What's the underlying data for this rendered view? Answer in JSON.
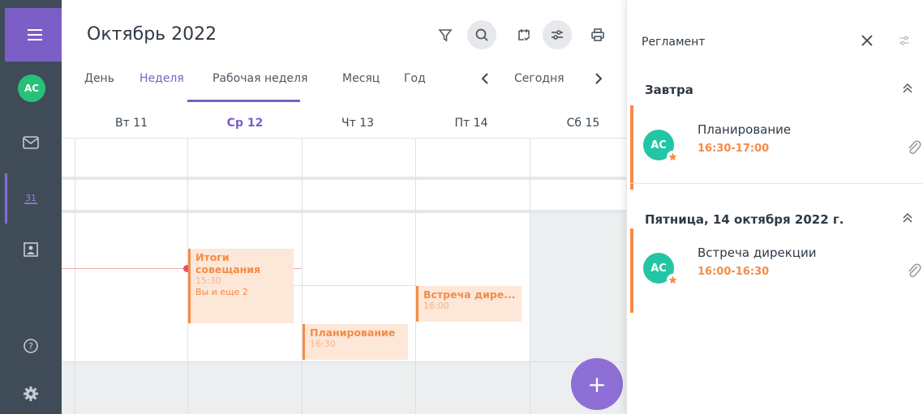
{
  "user": {
    "initials": "AC"
  },
  "calendar": {
    "title": "Октябрь 2022",
    "views": [
      "День",
      "Неделя",
      "Рабочая неделя",
      "Месяц",
      "Год"
    ],
    "selected_view": "Неделя",
    "today_label": "Сегодня",
    "days": [
      "Вт 11",
      "Ср 12",
      "Чт 13",
      "Пт 14",
      "Сб 15"
    ],
    "today_index": 1,
    "events": [
      {
        "title_line1": "Итоги",
        "title_line2": "совещания",
        "time": "15:30",
        "extra": "Вы и еще 2"
      },
      {
        "title": "Встреча дире...",
        "time": "16:00"
      },
      {
        "title": "Планирование",
        "time": "16:30"
      }
    ],
    "add_label": "+"
  },
  "panel": {
    "title": "Регламент",
    "sections": [
      {
        "title": "Завтра",
        "item": {
          "initials": "AC",
          "name": "Планирование",
          "time": "16:30-17:00"
        }
      },
      {
        "title": "Пятница, 14 октября 2022 г.",
        "item": {
          "initials": "AC",
          "name": "Встреча дирекции",
          "time": "16:00-16:30"
        }
      }
    ]
  },
  "colors": {
    "accent": "#7b5fc6",
    "event": "#f68b45",
    "rail": "#3f4c58",
    "avatar_green": "#27c17a",
    "avatar_teal": "#23c5a4"
  }
}
